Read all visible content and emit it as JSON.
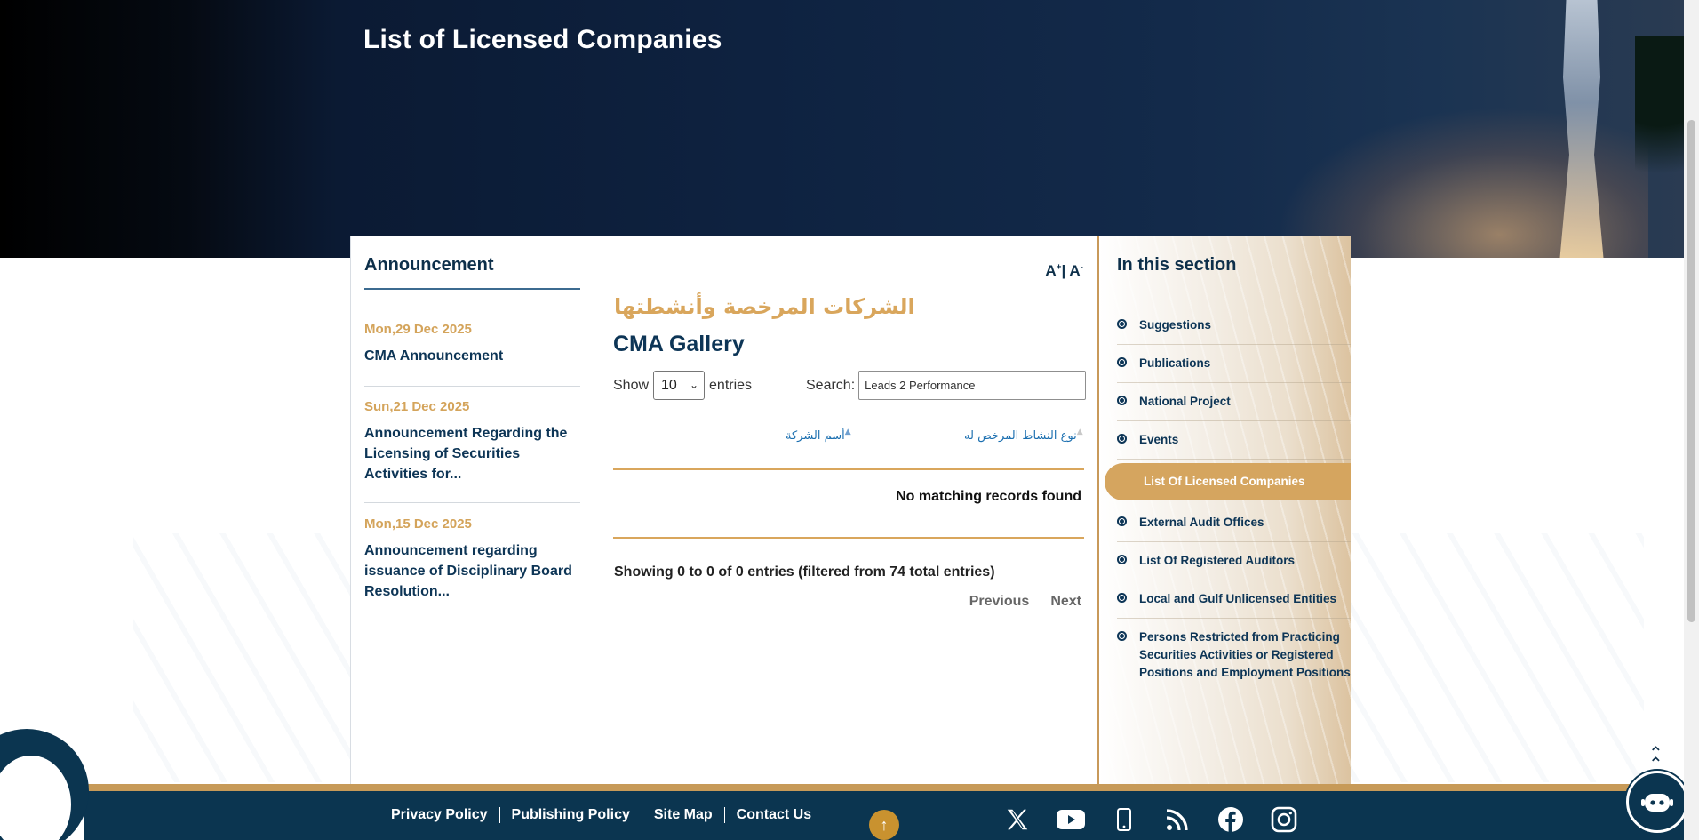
{
  "hero": {
    "title": "List of Licensed Companies"
  },
  "announcements": {
    "heading": "Announcement",
    "items": [
      {
        "date": "Mon,29 Dec 2025",
        "text": "CMA Announcement"
      },
      {
        "date": "Sun,21 Dec 2025",
        "text": "Announcement Regarding the Licensing of Securities Activities for..."
      },
      {
        "date": "Mon,15 Dec 2025",
        "text": "Announcement regarding issuance of Disciplinary Board Resolution..."
      }
    ]
  },
  "main": {
    "font_increase": "A",
    "font_increase_sup": "+",
    "font_sep": "|",
    "font_decrease": "A",
    "font_decrease_sup": "-",
    "arabic_title": "الشركات المرخصة وأنشطتها",
    "gallery_title": "CMA Gallery",
    "show_label": "Show",
    "entries_label": "entries",
    "page_size": "10",
    "search_label": "Search:",
    "search_value": "Leads 2 Performance",
    "columns": [
      "أسم الشركة",
      "نوع النشاط المرخص له"
    ],
    "empty_message": "No matching records found",
    "info": "Showing 0 to 0 of 0 entries (filtered from 74 total entries)",
    "prev_label": "Previous",
    "next_label": "Next"
  },
  "section": {
    "heading": "In this section",
    "items": [
      {
        "label": "Suggestions",
        "active": false
      },
      {
        "label": "Publications",
        "active": false
      },
      {
        "label": "National Project",
        "active": false
      },
      {
        "label": "Events",
        "active": false
      },
      {
        "label": "List Of Licensed Companies",
        "active": true
      },
      {
        "label": "External Audit Offices",
        "active": false
      },
      {
        "label": "List Of Registered Auditors",
        "active": false
      },
      {
        "label": "Local and Gulf Unlicensed Entities",
        "active": false
      },
      {
        "label": "Persons Restricted from Practicing Securities Activities or Registered Positions and Employment Positions",
        "active": false
      }
    ]
  },
  "footer": {
    "links": [
      "Privacy Policy",
      "Publishing Policy",
      "Site Map",
      "Contact Us"
    ],
    "social_icons": [
      "x-icon",
      "youtube-icon",
      "mobile-icon",
      "rss-icon",
      "facebook-icon",
      "instagram-icon"
    ]
  },
  "colors": {
    "navy": "#0b3550",
    "gold": "#d5a55f",
    "link_blue": "#1b6fb0"
  }
}
